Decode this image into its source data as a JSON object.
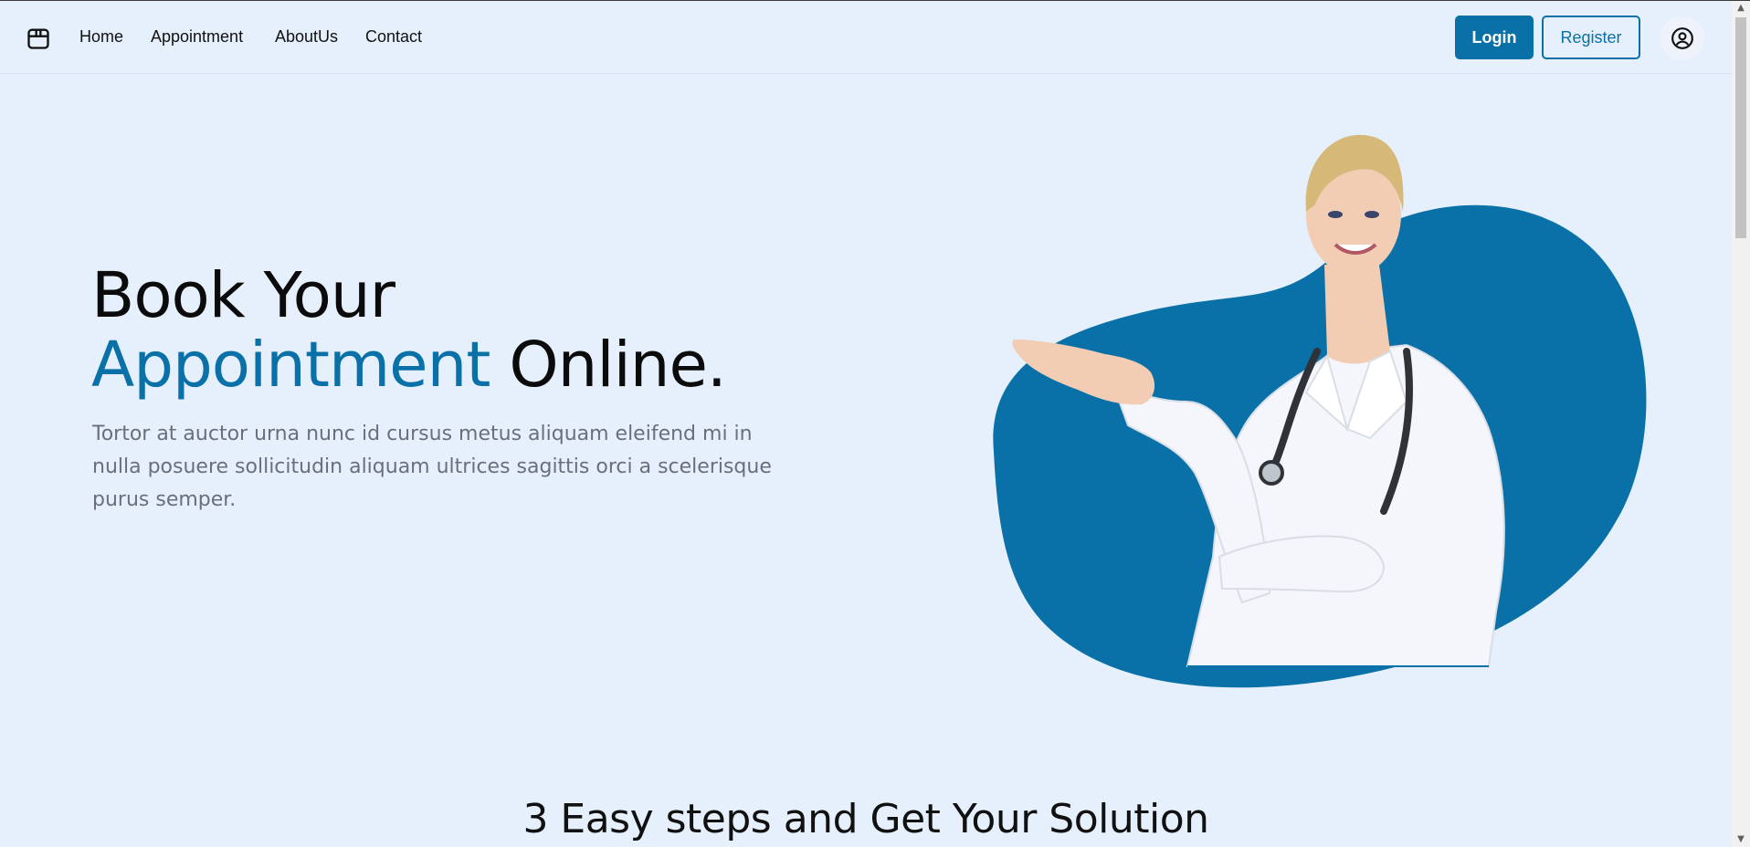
{
  "nav": {
    "logo_icon": "box-icon",
    "links": [
      "Home",
      "Appointment",
      "AboutUs",
      "Contact"
    ],
    "login_label": "Login",
    "register_label": "Register",
    "profile_icon": "user-circle-icon"
  },
  "hero": {
    "title_line1": "Book Your",
    "title_accent": "Appointment",
    "title_rest": " Online.",
    "description": "Tortor at auctor urna nunc id cursus metus aliquam eleifend mi in nulla posuere sollicitudin aliquam ultrices sagittis orci a scelerisque purus semper.",
    "image": "doctor-presenting-illustration"
  },
  "steps_section": {
    "title": "3 Easy steps and Get Your Solution"
  },
  "colors": {
    "accent": "#0a70a8",
    "background": "#e6f0fd",
    "text_muted": "#6a6f78"
  }
}
